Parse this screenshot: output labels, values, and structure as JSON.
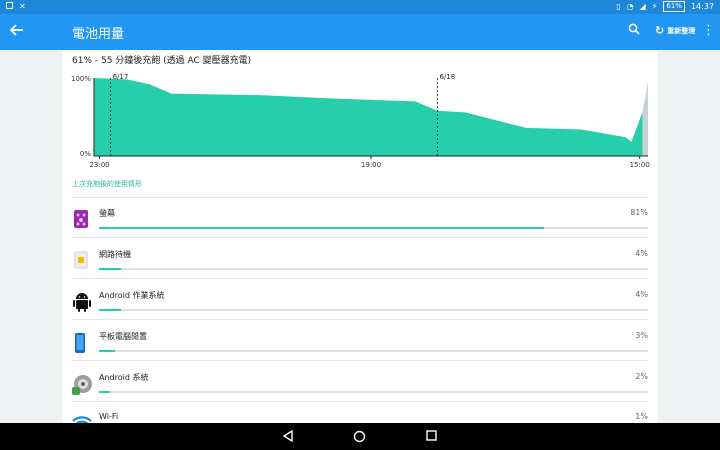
{
  "status_bar": {
    "time": "14:37",
    "battery": "61%"
  },
  "app_bar": {
    "title": "電池用量",
    "refresh_label": "重新整理"
  },
  "summary": "61% - 55 分鐘後充飽 (透過 AC 變壓器充電)",
  "chart_data": {
    "type": "area",
    "title": "",
    "ylabels": [
      "100%",
      "0%"
    ],
    "xlabels": [
      "23:00",
      "19:00",
      "15:00"
    ],
    "markers": [
      "6/17",
      "6/18"
    ],
    "ylim": [
      0,
      100
    ],
    "series": [
      {
        "values": [
          [
            0,
            100
          ],
          [
            0.06,
            98
          ],
          [
            0.1,
            92
          ],
          [
            0.14,
            80
          ],
          [
            0.3,
            78
          ],
          [
            0.42,
            74
          ],
          [
            0.58,
            70
          ],
          [
            0.62,
            58
          ],
          [
            0.67,
            56
          ],
          [
            0.73,
            45
          ],
          [
            0.78,
            36
          ],
          [
            0.88,
            34
          ],
          [
            0.96,
            24
          ],
          [
            0.97,
            18
          ],
          [
            0.99,
            56
          ]
        ],
        "projected": [
          [
            0.99,
            56
          ],
          [
            1.0,
            95
          ]
        ]
      }
    ]
  },
  "section_title": "上次充飽後的使用情形",
  "items": [
    {
      "label": "螢幕",
      "percent_text": "81%",
      "percent": 81,
      "icon": "screen-icon"
    },
    {
      "label": "網路待機",
      "percent_text": "4%",
      "percent": 4,
      "icon": "sim-icon"
    },
    {
      "label": "Android 作業系統",
      "percent_text": "4%",
      "percent": 4,
      "icon": "android-icon"
    },
    {
      "label": "平板電腦閒置",
      "percent_text": "3%",
      "percent": 3,
      "icon": "tablet-icon"
    },
    {
      "label": "Android 系統",
      "percent_text": "2%",
      "percent": 2,
      "icon": "android-system-icon"
    },
    {
      "label": "Wi-Fi",
      "percent_text": "1%",
      "percent": 1,
      "icon": "wifi-icon"
    }
  ],
  "colors": {
    "accent": "#26cfaa",
    "appbar": "#2196f3",
    "statusbar": "#1e88d8"
  }
}
